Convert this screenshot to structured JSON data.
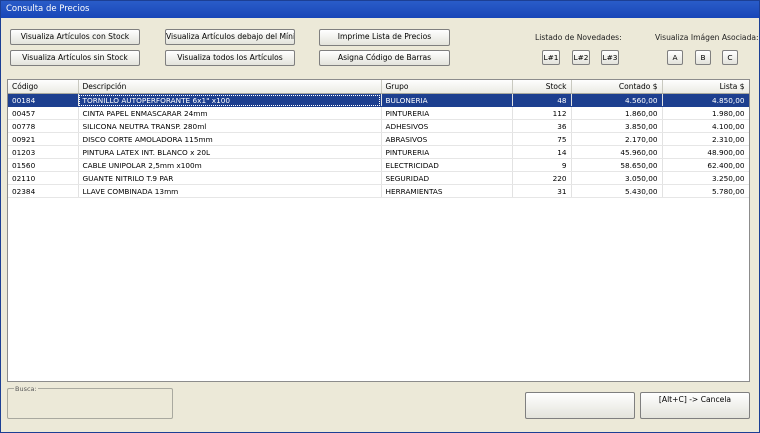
{
  "window": {
    "title": "Consulta de Precios"
  },
  "buttons": {
    "con_stock": "Visualiza Artículos con Stock",
    "sin_stock": "Visualiza Artículos sin Stock",
    "debajo_minimo": "Visualiza Artículos debajo del Mínimo",
    "todos": "Visualiza todos los Artículos",
    "imprime_lista": "Imprime Lista de Precios",
    "asigna_codigo": "Asigna Código de Barras"
  },
  "novedades": {
    "label": "Listado de Novedades:",
    "items": [
      "L#1",
      "L#2",
      "L#3"
    ]
  },
  "imagen": {
    "label": "Visualiza Imágen Asociada:",
    "items": [
      "A",
      "B",
      "C"
    ]
  },
  "table": {
    "columns": [
      "Código",
      "Descripción",
      "Grupo",
      "Stock",
      "Contado $",
      "Lista $"
    ],
    "rows": [
      [
        "00184",
        "TORNILLO AUTOPERFORANTE 6x1\" x100",
        "BULONERIA",
        "48",
        "4.560,00",
        "4.850,00"
      ],
      [
        "00457",
        "CINTA PAPEL ENMASCARAR 24mm",
        "PINTURERIA",
        "112",
        "1.860,00",
        "1.980,00"
      ],
      [
        "00778",
        "SILICONA NEUTRA TRANSP. 280ml",
        "ADHESIVOS",
        "36",
        "3.850,00",
        "4.100,00"
      ],
      [
        "00921",
        "DISCO CORTE AMOLADORA 115mm",
        "ABRASIVOS",
        "75",
        "2.170,00",
        "2.310,00"
      ],
      [
        "01203",
        "PINTURA LATEX INT. BLANCO x 20L",
        "PINTURERIA",
        "14",
        "45.960,00",
        "48.900,00"
      ],
      [
        "01560",
        "CABLE UNIPOLAR 2,5mm x100m",
        "ELECTRICIDAD",
        "9",
        "58.650,00",
        "62.400,00"
      ],
      [
        "02110",
        "GUANTE NITRILO T.9 PAR",
        "SEGURIDAD",
        "220",
        "3.050,00",
        "3.250,00"
      ],
      [
        "02384",
        "LLAVE COMBINADA 13mm",
        "HERRAMIENTAS",
        "31",
        "5.430,00",
        "5.780,00"
      ]
    ],
    "selected_row": 0
  },
  "busca": {
    "label": "Busca:",
    "value": ""
  },
  "footer": {
    "blank_button": "",
    "cancel_button": "[Alt+C] -> Cancela"
  },
  "colors": {
    "titlebar": "#1846b8",
    "selection": "#1d3f8f",
    "window_bg": "#ece9d8"
  }
}
